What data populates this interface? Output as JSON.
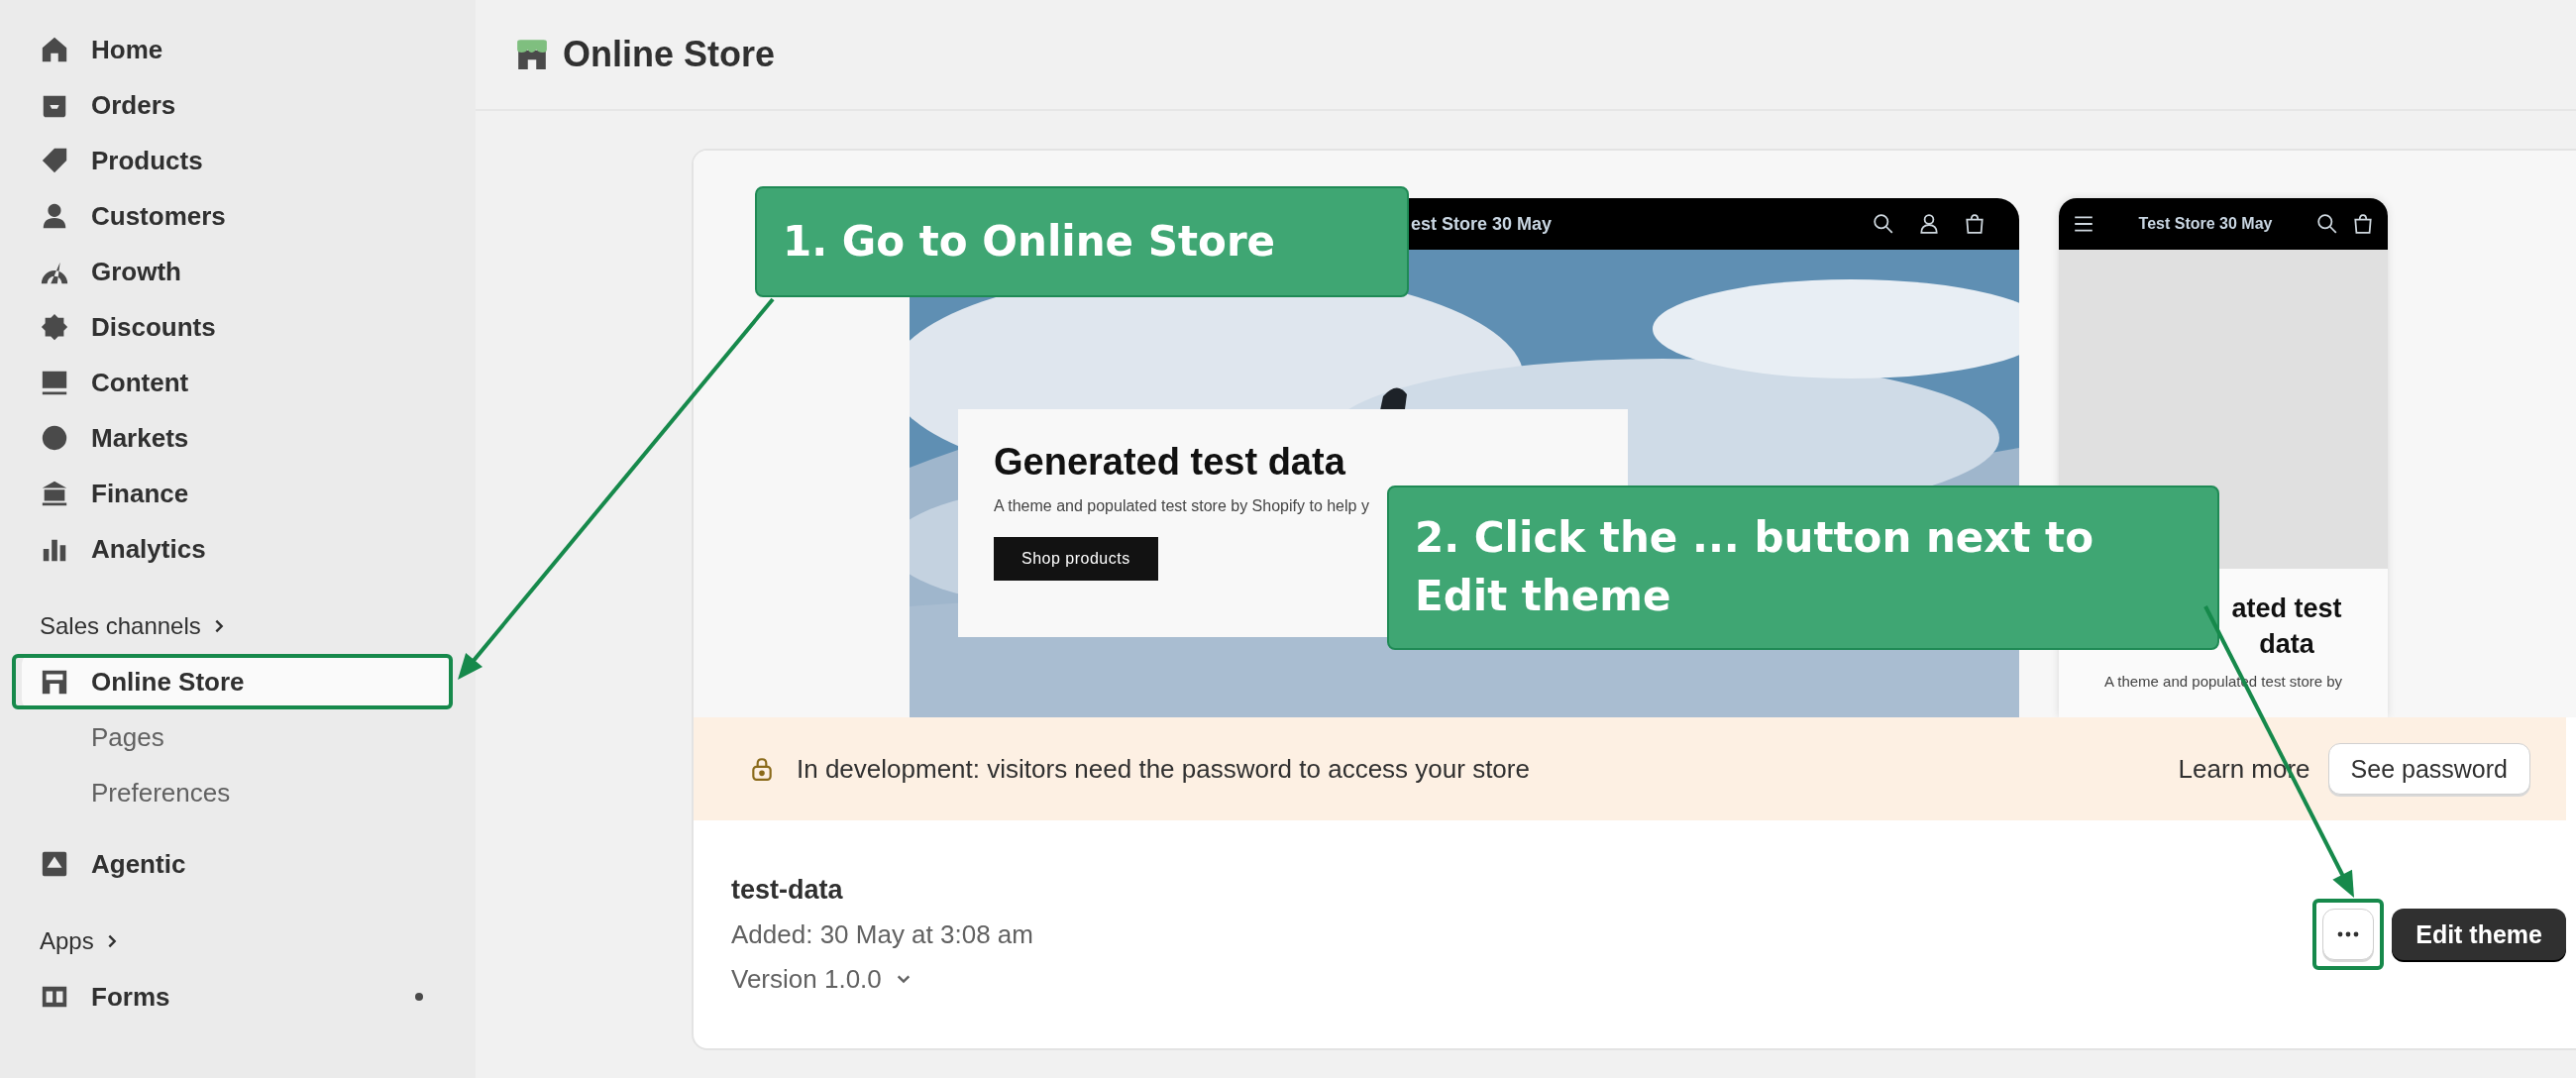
{
  "sidebar": {
    "items": [
      {
        "kind": "nav",
        "label": "Home",
        "selected": false,
        "highlighted": false,
        "dot": false
      },
      {
        "kind": "nav",
        "label": "Orders",
        "selected": false,
        "highlighted": false,
        "dot": false
      },
      {
        "kind": "nav",
        "label": "Products",
        "selected": false,
        "highlighted": false,
        "dot": false
      },
      {
        "kind": "nav",
        "label": "Customers",
        "selected": false,
        "highlighted": false,
        "dot": false
      },
      {
        "kind": "nav",
        "label": "Growth",
        "selected": false,
        "highlighted": false,
        "dot": false
      },
      {
        "kind": "nav",
        "label": "Discounts",
        "selected": false,
        "highlighted": false,
        "dot": false
      },
      {
        "kind": "nav",
        "label": "Content",
        "selected": false,
        "highlighted": false,
        "dot": false
      },
      {
        "kind": "nav",
        "label": "Markets",
        "selected": false,
        "highlighted": false,
        "dot": false
      },
      {
        "kind": "nav",
        "label": "Finance",
        "selected": false,
        "highlighted": false,
        "dot": false
      },
      {
        "kind": "nav",
        "label": "Analytics",
        "selected": false,
        "highlighted": false,
        "dot": false
      },
      {
        "kind": "heading",
        "label": "Sales channels"
      },
      {
        "kind": "nav",
        "label": "Online Store",
        "selected": true,
        "highlighted": true,
        "dot": false
      },
      {
        "kind": "sub",
        "label": "Pages"
      },
      {
        "kind": "sub",
        "label": "Preferences"
      },
      {
        "kind": "nav",
        "label": "Agentic",
        "selected": false,
        "highlighted": false,
        "dot": false
      },
      {
        "kind": "heading",
        "label": "Apps"
      },
      {
        "kind": "nav",
        "label": "Forms",
        "selected": false,
        "highlighted": false,
        "dot": true
      }
    ]
  },
  "page": {
    "title": "Online Store"
  },
  "theme_preview": {
    "desktop": {
      "store_name": "est Store 30 May",
      "heading": "Generated test data",
      "text": "A theme and populated test store by Shopify to help y",
      "button": "Shop products"
    },
    "mobile": {
      "store_name": "Test Store 30 May",
      "heading": "ated test data",
      "text": "A theme and populated test store by"
    }
  },
  "banner": {
    "text": "In development: visitors need the password to access your store",
    "link": "Learn more",
    "button": "See password"
  },
  "theme": {
    "name": "test-data",
    "added": "Added: 30 May at 3:08 am",
    "version": "Version 1.0.0",
    "more_button": {
      "highlighted": true
    },
    "edit_button": "Edit theme"
  },
  "annotations": [
    {
      "kind": "callout",
      "text": "1. Go to Online Store"
    },
    {
      "kind": "callout",
      "text": "2. Click the ... button next to Edit theme"
    }
  ]
}
